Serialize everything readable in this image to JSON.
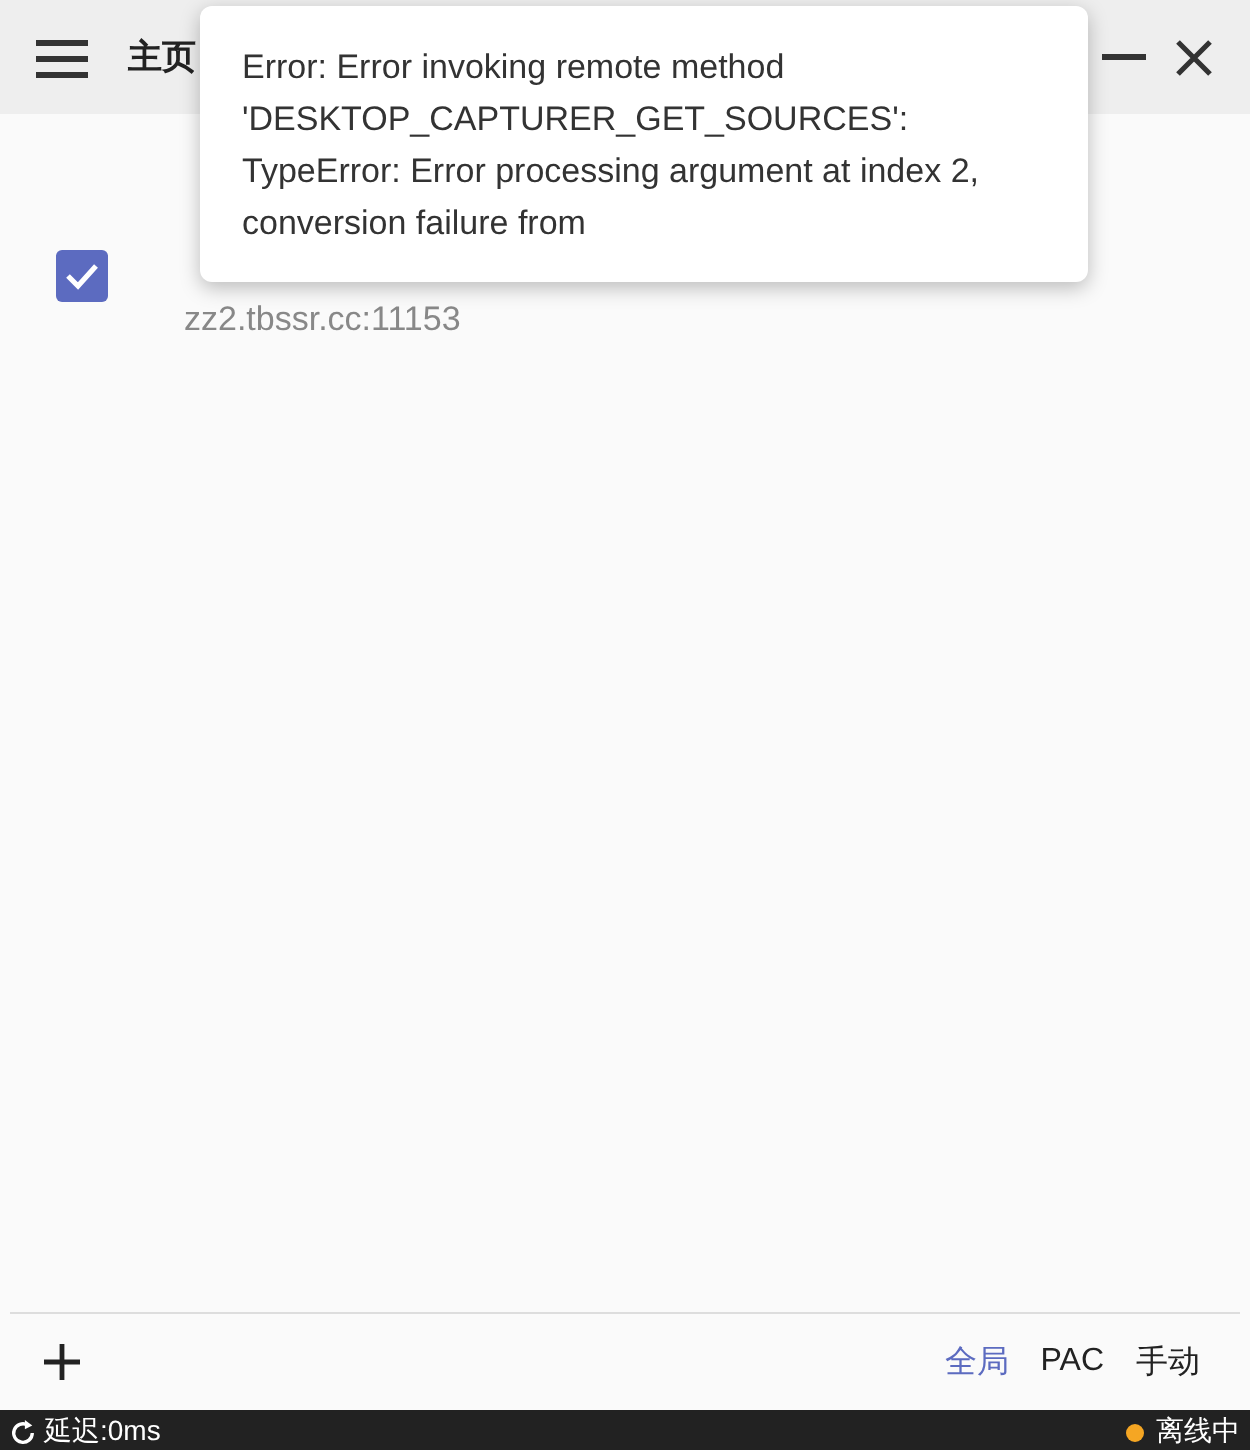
{
  "header": {
    "title": "主页"
  },
  "servers": [
    {
      "address": "zz2.tbssr.cc:11153",
      "checked": true
    }
  ],
  "toast": {
    "message": "Error: Error invoking remote method 'DESKTOP_CAPTURER_GET_SOURCES': TypeError: Error processing argument at index 2, conversion failure from"
  },
  "modes": [
    {
      "label": "全局",
      "selected": true
    },
    {
      "label": "PAC",
      "selected": false
    },
    {
      "label": "手动",
      "selected": false
    }
  ],
  "status_bar": {
    "latency": "延迟:0ms",
    "status": "离线中",
    "color": "#f5a623"
  }
}
